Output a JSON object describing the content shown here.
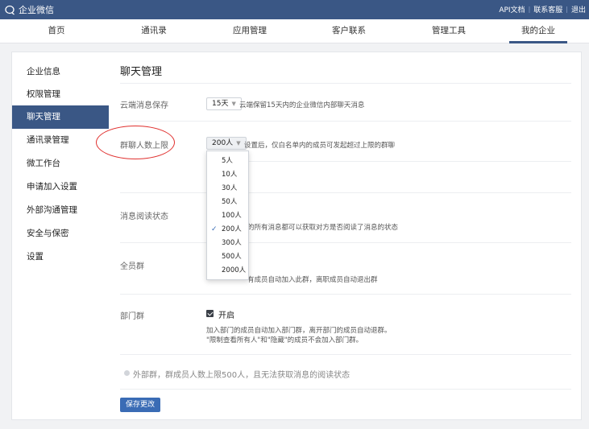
{
  "app": {
    "title": "企业微信"
  },
  "top_links": [
    "API文档",
    "联系客服",
    "退出"
  ],
  "nav": {
    "items": [
      "首页",
      "通讯录",
      "应用管理",
      "客户联系",
      "管理工具",
      "我的企业"
    ],
    "active_index": 5
  },
  "sidebar": {
    "items": [
      "企业信息",
      "权限管理",
      "聊天管理",
      "通讯录管理",
      "微工作台",
      "申请加入设置",
      "外部沟通管理",
      "安全与保密",
      "设置"
    ],
    "active_index": 2
  },
  "main": {
    "title": "聊天管理",
    "cloud": {
      "label": "云端消息保存",
      "value": "15天",
      "hint": "云端保留15天内的企业微信内部聊天消息"
    },
    "group_limit": {
      "label": "群聊人数上限",
      "value": "200人",
      "hint": "设置后，仅白名单内的成员可发起超过上限的群聊",
      "options": [
        "5人",
        "10人",
        "30人",
        "50人",
        "100人",
        "200人",
        "300人",
        "500人",
        "2000人"
      ],
      "selected_index": 5
    },
    "read_status": {
      "label": "消息阅读状态",
      "hint_partial": "的所有消息都可以获取对方是否阅读了消息的状态"
    },
    "all_member_group": {
      "label": "全员群",
      "hint_partial": "有成员自动加入此群，离职成员自动退出群"
    },
    "dept_group": {
      "label": "部门群",
      "toggle_label": "开启",
      "hint_line1": "加入部门的成员自动加入部门群，离开部门的成员自动退群。",
      "hint_line2": "\"限制查看所有人\"和\"隐藏\"的成员不会加入部门群。"
    },
    "external_note": "外部群，群成员人数上限500人，且无法获取消息的阅读状态",
    "save_label": "保存更改"
  },
  "colors": {
    "header": "#3a5785",
    "accent": "#3a6cb5",
    "annotation": "#e0302e"
  }
}
